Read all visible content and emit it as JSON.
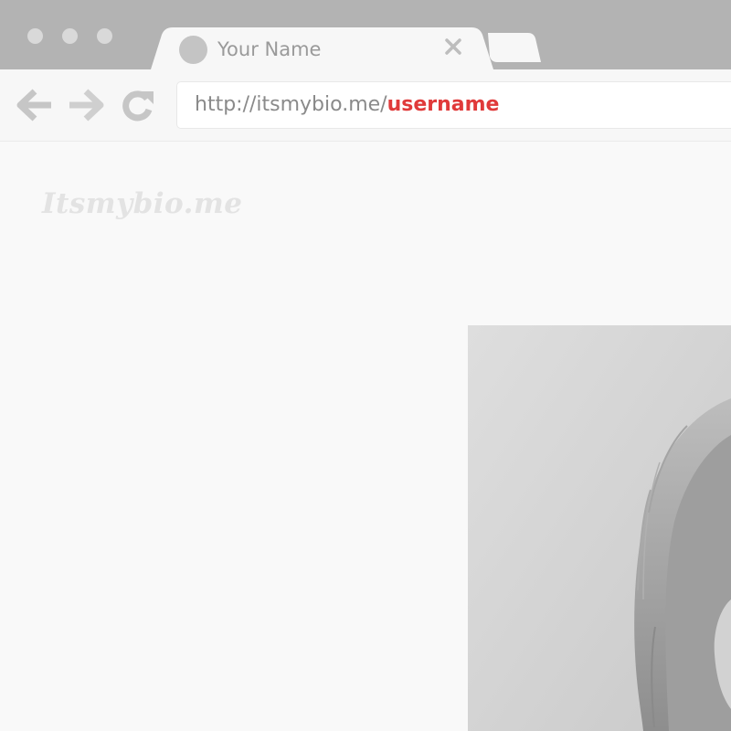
{
  "window": {
    "controls": [
      "close-dot",
      "minimize-dot",
      "maximize-dot"
    ]
  },
  "tab": {
    "title": "Your Name",
    "favicon": "circle-placeholder-icon",
    "close_icon": "close-icon"
  },
  "toolbar": {
    "back_icon": "arrow-left-icon",
    "forward_icon": "arrow-right-icon",
    "reload_icon": "reload-icon",
    "url_base": "http://itsmybio.me/",
    "url_username": "username",
    "accent_color": "#e03a3a"
  },
  "page": {
    "logo": "Itsmybio.me"
  }
}
